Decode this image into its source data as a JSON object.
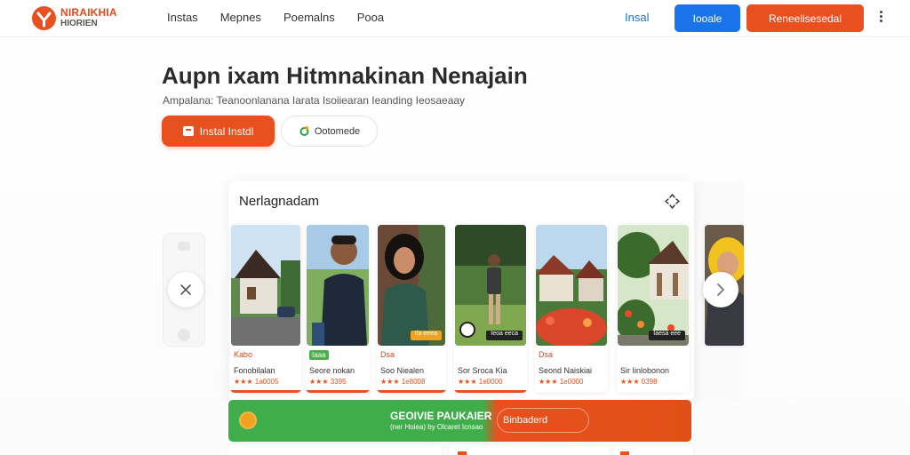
{
  "header": {
    "logo_line1": "NIRAIKHIA",
    "logo_line2": "HIORIEN",
    "nav": [
      "Instas",
      "Mepnes",
      "Poemalns",
      "Pooa"
    ],
    "install_link": "Insal",
    "primary_button": "Iooale",
    "cta_button": "Reneelisesedal"
  },
  "hero": {
    "title": "Aupn ixam Hitmnakinan Nenajain",
    "subtitle": "Ampalana: Teanoonlanana Iarata Isoiiearan Ieanding Ieosaeaay",
    "install_button": "Instal Instdl",
    "secondary_button": "Ootomede",
    "secondary_icon": "leaf-icon"
  },
  "widget": {
    "title": "Nerlagnadam",
    "tiles": [
      {
        "badge": "Kabo",
        "badge_style": "text",
        "name": "Fonobilalan",
        "rating": "★★★ 1a0005",
        "tag": ""
      },
      {
        "badge": "Iaaa",
        "badge_style": "green",
        "name": "Seore nokan",
        "rating": "★★★ 3395",
        "tag": ""
      },
      {
        "badge": "Dsa",
        "badge_style": "text",
        "name": "Soo Niealen",
        "rating": "★★★ 1e8008",
        "tag": "Ifa eeea"
      },
      {
        "badge": "",
        "badge_style": "text",
        "name": "Sor Sroca Kia",
        "rating": "★★★ 1e0000",
        "tag": "Ieoa eeca"
      },
      {
        "badge": "Dsa",
        "badge_style": "text",
        "name": "Seond Naiskiai",
        "rating": "★★★ 1e0000",
        "tag": ""
      },
      {
        "badge": "",
        "badge_style": "text",
        "name": "Sir Iinlobonon",
        "rating": "★★★ 0398",
        "tag": "Iaesa eee"
      }
    ]
  },
  "promo": {
    "title": "GEOIVIE PAUKAIER",
    "subtitle": "(ner Hoiea) by Olcaret Icnsao",
    "button": "Binbaderd"
  },
  "colors": {
    "brand_orange": "#e8501f",
    "primary_blue": "#1a73e8",
    "promo_green": "#3fae4a"
  }
}
